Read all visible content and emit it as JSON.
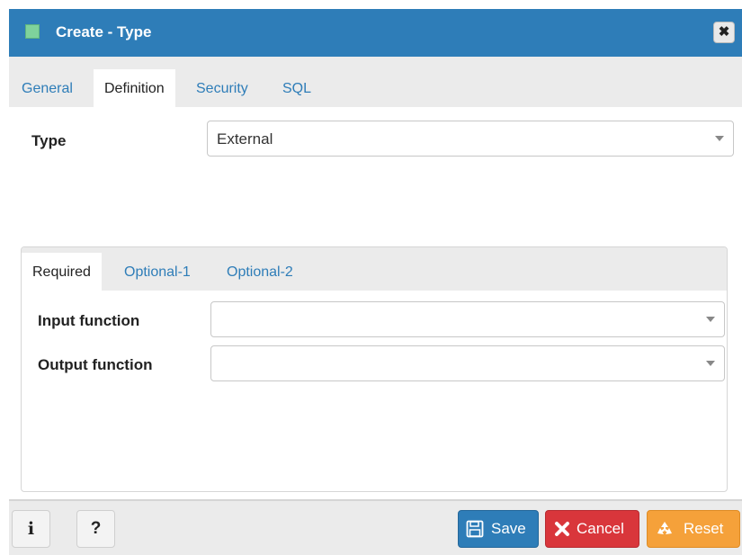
{
  "dialog": {
    "title": "Create - Type",
    "close_label": "✖"
  },
  "tabs": [
    {
      "label": "General"
    },
    {
      "label": "Definition",
      "active": true
    },
    {
      "label": "Security"
    },
    {
      "label": "SQL"
    }
  ],
  "definition": {
    "type_label": "Type",
    "type_value": "External"
  },
  "subtabs": [
    {
      "label": "Required",
      "active": true
    },
    {
      "label": "Optional-1"
    },
    {
      "label": "Optional-2"
    }
  ],
  "required": {
    "input_function_label": "Input function",
    "input_function_value": "",
    "output_function_label": "Output function",
    "output_function_value": ""
  },
  "footer": {
    "info_label": "i",
    "help_label": "?",
    "save_label": "Save",
    "cancel_label": "Cancel",
    "reset_label": "Reset"
  },
  "colors": {
    "titlebar": "#2e7db8",
    "save": "#2e7db8",
    "cancel": "#d9363b",
    "reset": "#f5a13a"
  }
}
